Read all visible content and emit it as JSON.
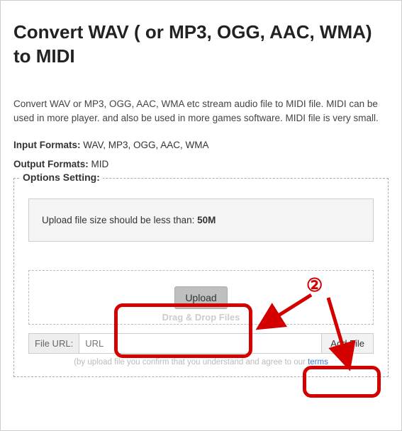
{
  "title": "Convert WAV ( or MP3, OGG, AAC, WMA) to MIDI",
  "intro": "Convert WAV or MP3, OGG, AAC, WMA etc stream audio file to MIDI file. MIDI can be used in more player. and also be used in more games software. MIDI file is very small.",
  "input_formats_label": "Input Formats:",
  "input_formats_value": "WAV, MP3, OGG, AAC, WMA",
  "output_formats_label": "Output Formats:",
  "output_formats_value": "MID",
  "options": {
    "legend": "Options Setting:",
    "size_prefix": "Upload file size should be less than: ",
    "size_limit": "50M",
    "upload_label": "Upload",
    "drag_text": "Drag & Drop Files",
    "url_label": "File URL:",
    "url_placeholder": "URL",
    "addfile_label": "Add File",
    "confirm_prefix": "(by upload file you confirm that you understand and agree to our ",
    "confirm_link": "terms"
  },
  "annotation": {
    "step_badge": "②"
  }
}
